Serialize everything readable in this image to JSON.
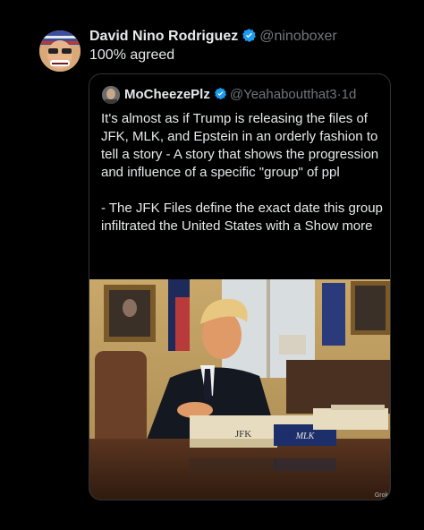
{
  "tweet": {
    "author_name": "David Nino Rodriguez",
    "handle": "@ninoboxer",
    "text": "100% agreed"
  },
  "quote": {
    "author_name": "MoCheezePlz",
    "handle": "@Yeahaboutthat3",
    "separator": "·",
    "time": "1d",
    "text": "It's almost as if Trump is releasing the files of JFK, MLK, and Epstein in an orderly fashion to tell a story - A story that shows the progression and influence of a specific \"group\" of ppl\n\n- The JFK Files define the exact date this group infiltrated the United States with a ",
    "show_more": "Show more",
    "image": {
      "book_labels": [
        "JFK",
        "MLK"
      ],
      "corner_label": "Grok"
    }
  },
  "colors": {
    "background": "#000000",
    "text_primary": "#e7e9ea",
    "text_secondary": "#71767b",
    "verified_blue": "#1d9bf0",
    "border": "#2f3336"
  },
  "icons": {
    "verified": "verified-badge-icon"
  }
}
